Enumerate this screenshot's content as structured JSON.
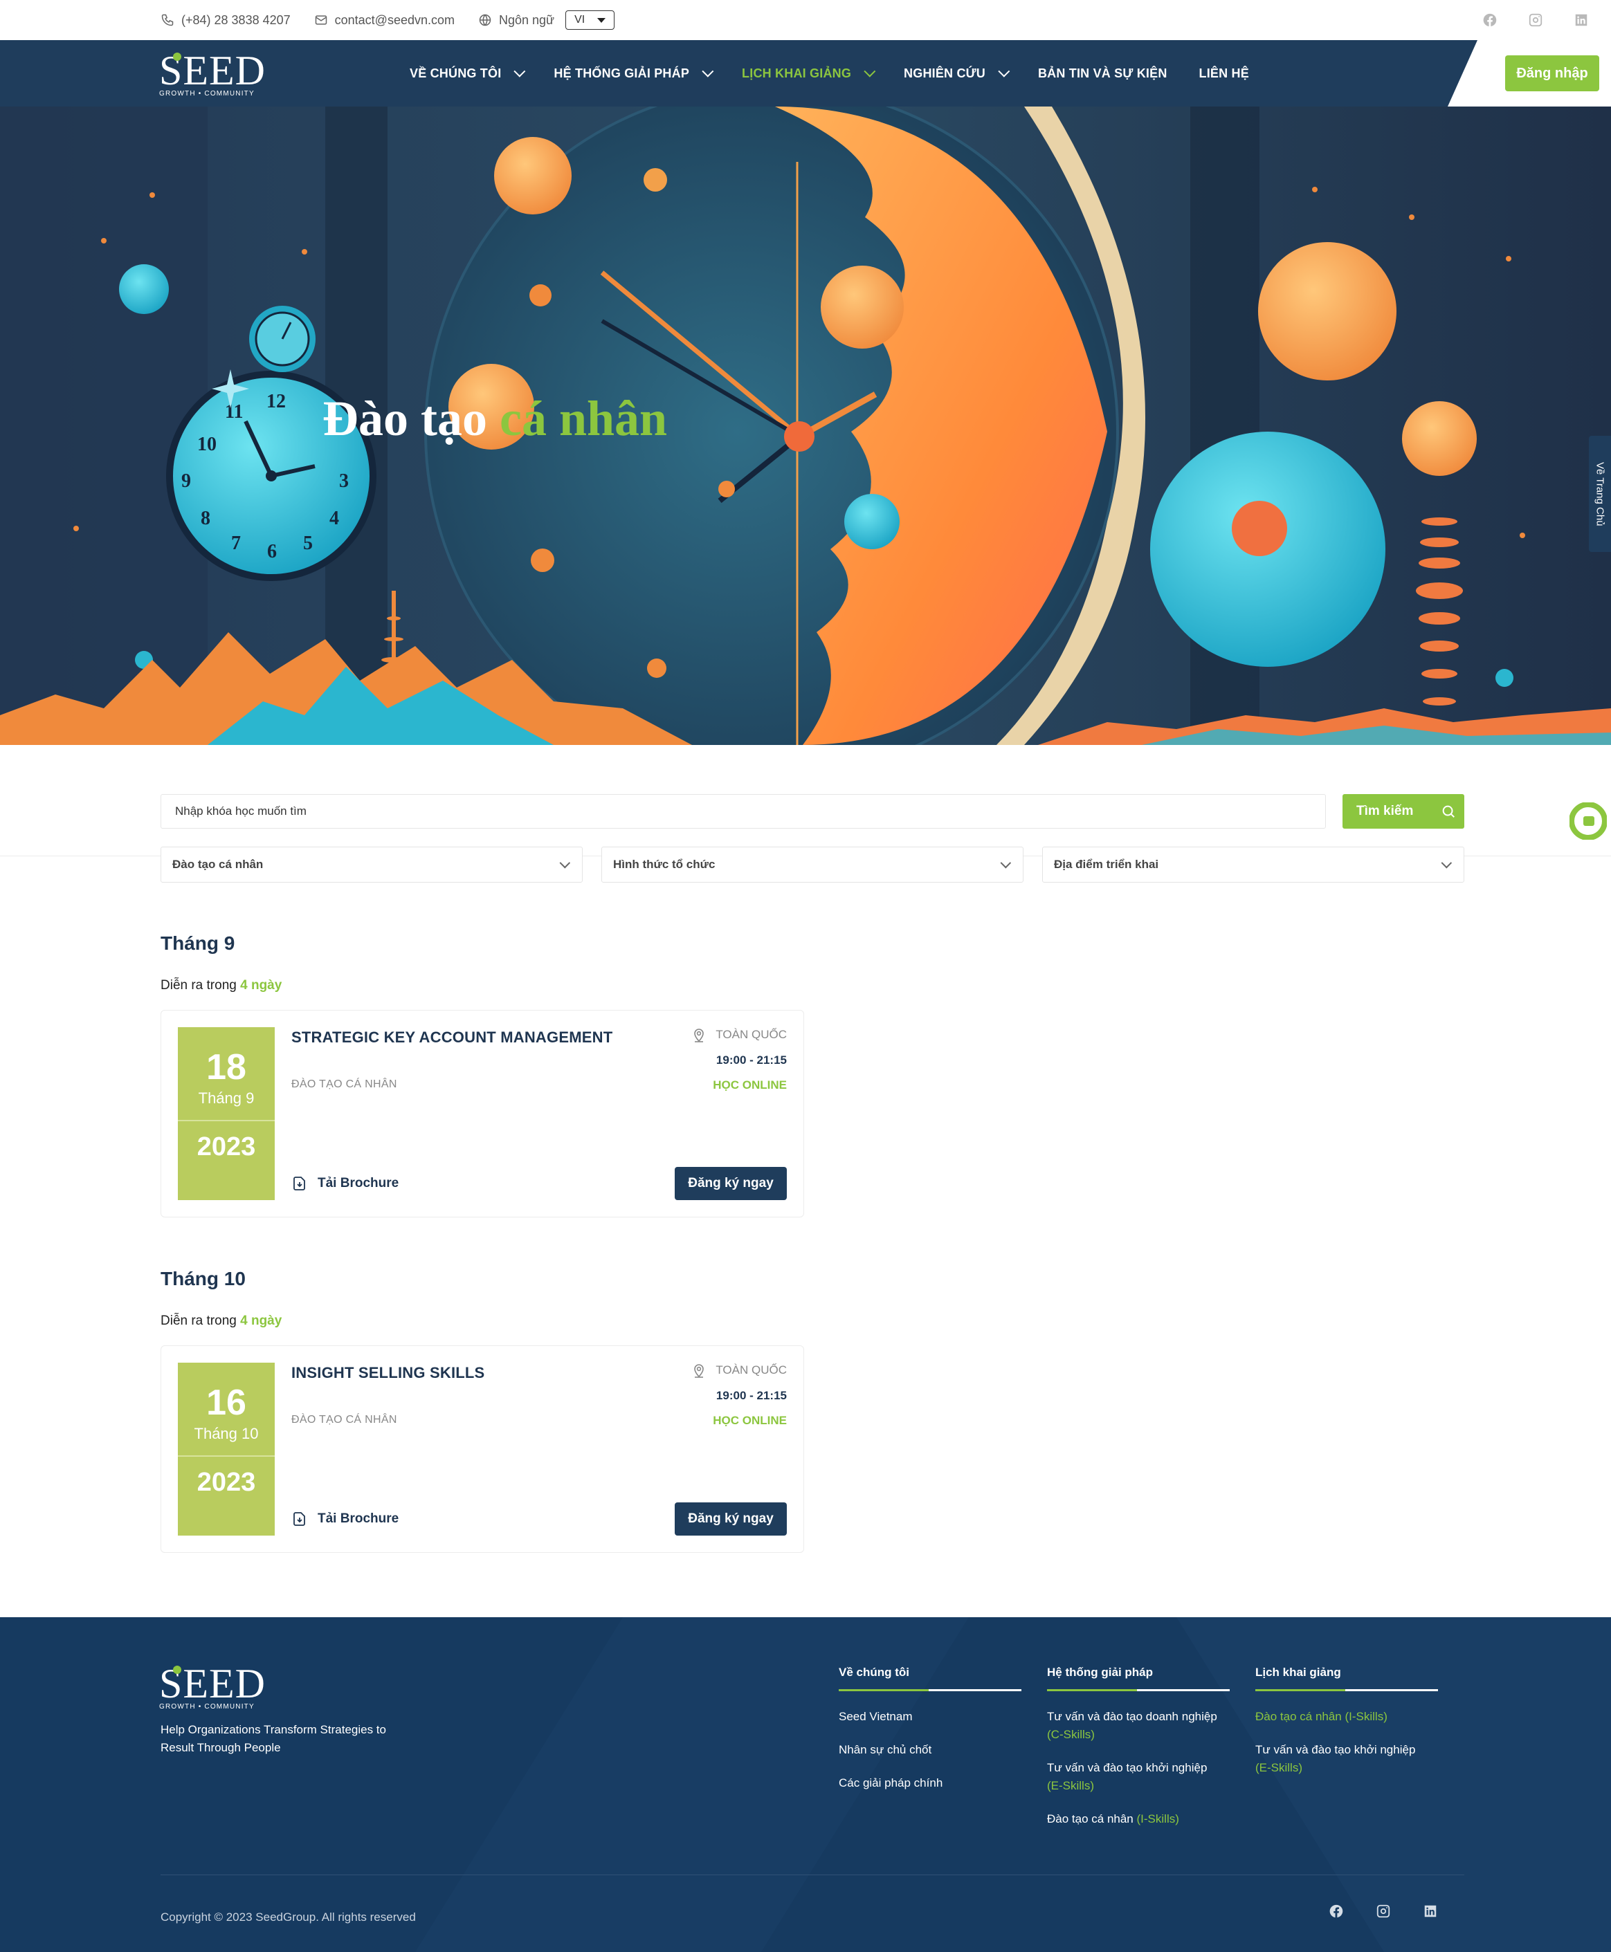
{
  "topbar": {
    "phone": "(+84) 28 3838 4207",
    "email": "contact@seedvn.com",
    "language_label": "Ngôn ngữ",
    "language_value": "VI",
    "icons": [
      "phone-icon",
      "mail-icon",
      "globe-icon",
      "facebook-icon",
      "instagram-icon",
      "linkedin-icon"
    ]
  },
  "brand": {
    "name": "SEED",
    "tagline": "GROWTH • COMMUNITY",
    "accent": "#8cc63f",
    "navy": "#1f3d5c"
  },
  "nav": {
    "items": [
      {
        "label": "VỀ CHÚNG TÔI",
        "dropdown": true
      },
      {
        "label": "HỆ THỐNG GIẢI PHÁP",
        "dropdown": true
      },
      {
        "label": "LỊCH KHAI GIẢNG",
        "dropdown": true,
        "active": true
      },
      {
        "label": "NGHIÊN CỨU",
        "dropdown": true
      },
      {
        "label": "BẢN TIN VÀ SỰ KIỆN",
        "dropdown": false
      },
      {
        "label": "LIÊN HỆ",
        "dropdown": false
      }
    ],
    "login_label": "Đăng nhập"
  },
  "hero": {
    "title_main": "Đào tạo",
    "title_accent": "cá nhân",
    "side_tab": "Về Trang Chủ"
  },
  "search": {
    "placeholder": "Nhập khóa học muốn tìm",
    "button_label": "Tìm kiếm",
    "filters": [
      "Đào tạo cá nhân",
      "Hình thức tổ chức",
      "Địa điểm triển khai"
    ]
  },
  "months": [
    {
      "title": "Tháng 9",
      "subtitle_prefix": "Diễn ra trong",
      "subtitle_days": "4 ngày",
      "course": {
        "day": "18",
        "month": "Tháng 9",
        "year": "2023",
        "title": "STRATEGIC KEY ACCOUNT MANAGEMENT",
        "category": "ĐÀO TẠO CÁ NHÂN",
        "location": "TOÀN QUỐC",
        "time": "19:00 - 21:15",
        "mode": "HỌC ONLINE",
        "brochure": "Tải Brochure",
        "register": "Đăng ký ngay"
      }
    },
    {
      "title": "Tháng 10",
      "subtitle_prefix": "Diễn ra trong",
      "subtitle_days": "4 ngày",
      "course": {
        "day": "16",
        "month": "Tháng 10",
        "year": "2023",
        "title": "INSIGHT SELLING SKILLS",
        "category": "ĐÀO TẠO CÁ NHÂN",
        "location": "TOÀN QUỐC",
        "time": "19:00 - 21:15",
        "mode": "HỌC ONLINE",
        "brochure": "Tải Brochure",
        "register": "Đăng ký ngay"
      }
    }
  ],
  "footer": {
    "slogan": "Help Organizations Transform Strategies to Result Through People",
    "columns": [
      {
        "title": "Về chúng tôi",
        "items": [
          "Seed Vietnam",
          "Nhân sự chủ chốt",
          "Các giải pháp chính"
        ]
      },
      {
        "title": "Hệ thống giải pháp",
        "items": [
          {
            "text": "Tư vấn và đào tạo doanh nghiệp",
            "tag": "(C-Skills)"
          },
          {
            "text": "Tư vấn và đào tạo khởi nghiệp",
            "tag": "(E-Skills)"
          },
          {
            "text": "Đào tạo cá nhân",
            "tag": "(I-Skills)"
          }
        ]
      },
      {
        "title": "Lịch khai giảng",
        "items": [
          {
            "text": "Đào tạo cá nhân (I-Skills)",
            "tag": ""
          },
          {
            "text": "Tư vấn và đào tạo khởi nghiệp",
            "tag": "(E-Skills)"
          }
        ]
      }
    ],
    "copyright": "Copyright © 2023 SeedGroup. All rights reserved"
  }
}
